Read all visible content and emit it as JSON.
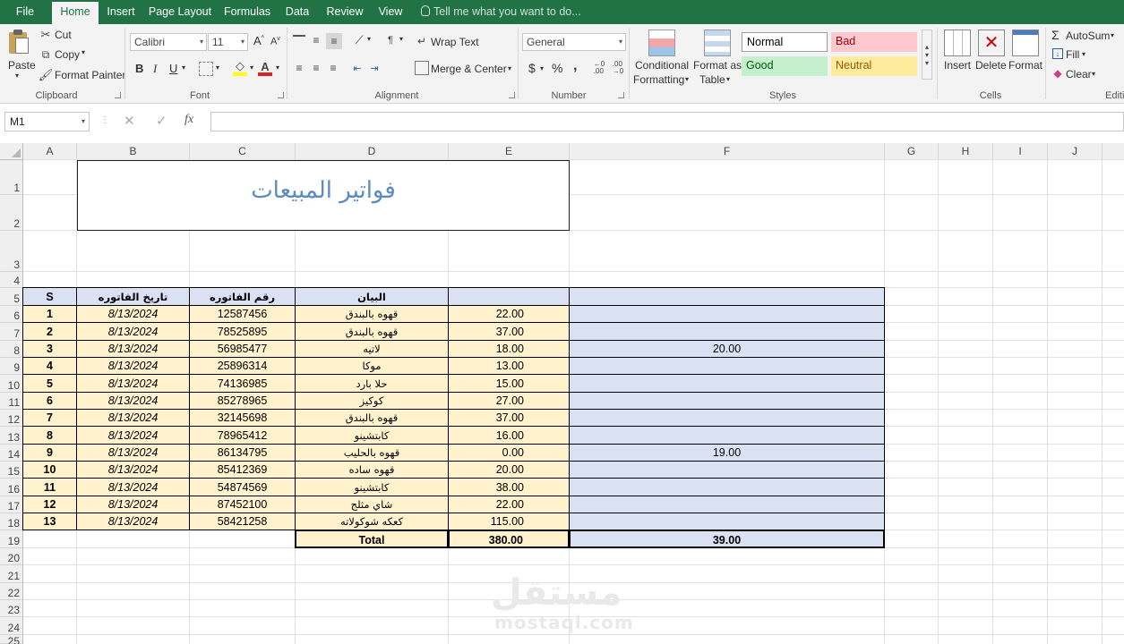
{
  "ribbon_tabs": [
    "File",
    "Home",
    "Insert",
    "Page Layout",
    "Formulas",
    "Data",
    "Review",
    "View"
  ],
  "active_tab": "Home",
  "tell_me": "Tell me what you want to do...",
  "clipboard": {
    "paste": "Paste",
    "cut": "Cut",
    "copy": "Copy",
    "format_painter": "Format Painter",
    "group": "Clipboard"
  },
  "font": {
    "name": "Calibri",
    "size": "11",
    "group": "Font",
    "bold": "B",
    "italic": "I",
    "underline": "U"
  },
  "alignment": {
    "wrap_text": "Wrap Text",
    "merge_center": "Merge & Center",
    "group": "Alignment"
  },
  "number": {
    "format": "General",
    "currency": "$",
    "percent": "%",
    "comma": ",",
    "group": "Number"
  },
  "styles": {
    "conditional_formatting": [
      "Conditional",
      "Formatting"
    ],
    "format_as_table": [
      "Format as",
      "Table"
    ],
    "normal": "Normal",
    "bad": "Bad",
    "good": "Good",
    "neutral": "Neutral",
    "group": "Styles",
    "colors": {
      "normal": "#ffffff",
      "bad": "#ffc7ce",
      "good": "#c6efce",
      "neutral": "#ffeb9c"
    }
  },
  "cells_group": {
    "insert": "Insert",
    "delete": "Delete",
    "format": "Format",
    "group": "Cells"
  },
  "editing": {
    "autosum": "AutoSum",
    "fill": "Fill",
    "clear": "Clear",
    "group": "Editi"
  },
  "name_box": "M1",
  "columns": [
    "A",
    "B",
    "C",
    "D",
    "E",
    "F",
    "G",
    "H",
    "I",
    "J"
  ],
  "rows": [
    "1",
    "2",
    "3",
    "4",
    "5",
    "6",
    "7",
    "8",
    "9",
    "10",
    "11",
    "12",
    "13",
    "14",
    "15",
    "16",
    "17",
    "18",
    "19",
    "20",
    "21",
    "22",
    "23",
    "24",
    "25"
  ],
  "sheet": {
    "title": "فواتير المبيعات",
    "headers": {
      "s": "S",
      "date": "تاريخ الفاتوره",
      "number": "رقم الفاتوره",
      "desc": "البيان",
      "e": "",
      "f": ""
    },
    "rows": [
      {
        "s": "1",
        "date": "8/13/2024",
        "number": "12587456",
        "desc": "قهوه بالبندق",
        "e": "22.00",
        "f": ""
      },
      {
        "s": "2",
        "date": "8/13/2024",
        "number": "78525895",
        "desc": "قهوه بالبندق",
        "e": "37.00",
        "f": ""
      },
      {
        "s": "3",
        "date": "8/13/2024",
        "number": "56985477",
        "desc": "لاتيه",
        "e": "18.00",
        "f": "20.00"
      },
      {
        "s": "4",
        "date": "8/13/2024",
        "number": "25896314",
        "desc": "موكا",
        "e": "13.00",
        "f": ""
      },
      {
        "s": "5",
        "date": "8/13/2024",
        "number": "74136985",
        "desc": "حلا بارد",
        "e": "15.00",
        "f": ""
      },
      {
        "s": "6",
        "date": "8/13/2024",
        "number": "85278965",
        "desc": "كوكيز",
        "e": "27.00",
        "f": ""
      },
      {
        "s": "7",
        "date": "8/13/2024",
        "number": "32145698",
        "desc": "قهوه بالبندق",
        "e": "37.00",
        "f": ""
      },
      {
        "s": "8",
        "date": "8/13/2024",
        "number": "78965412",
        "desc": "كابتشينو",
        "e": "16.00",
        "f": ""
      },
      {
        "s": "9",
        "date": "8/13/2024",
        "number": "86134795",
        "desc": "قهوه بالحليب",
        "e": "0.00",
        "f": "19.00"
      },
      {
        "s": "10",
        "date": "8/13/2024",
        "number": "85412369",
        "desc": "قهوه ساده",
        "e": "20.00",
        "f": ""
      },
      {
        "s": "11",
        "date": "8/13/2024",
        "number": "54874569",
        "desc": "كابتشينو",
        "e": "38.00",
        "f": ""
      },
      {
        "s": "12",
        "date": "8/13/2024",
        "number": "87452100",
        "desc": "شاي مثلج",
        "e": "22.00",
        "f": ""
      },
      {
        "s": "13",
        "date": "8/13/2024",
        "number": "58421258",
        "desc": "كعكه شوكولاته",
        "e": "115.00",
        "f": ""
      }
    ],
    "total": {
      "label": "Total",
      "e": "380.00",
      "f": "39.00"
    },
    "colors": {
      "header_fill": "#d9e1f2",
      "row_fill": "#fff2cc",
      "f_fill": "#d9e1f2",
      "total_fill": "#fff2cc",
      "title_color": "#5b8bc0"
    }
  },
  "watermark": {
    "ar": "مستقل",
    "en": "mostaql.com"
  }
}
